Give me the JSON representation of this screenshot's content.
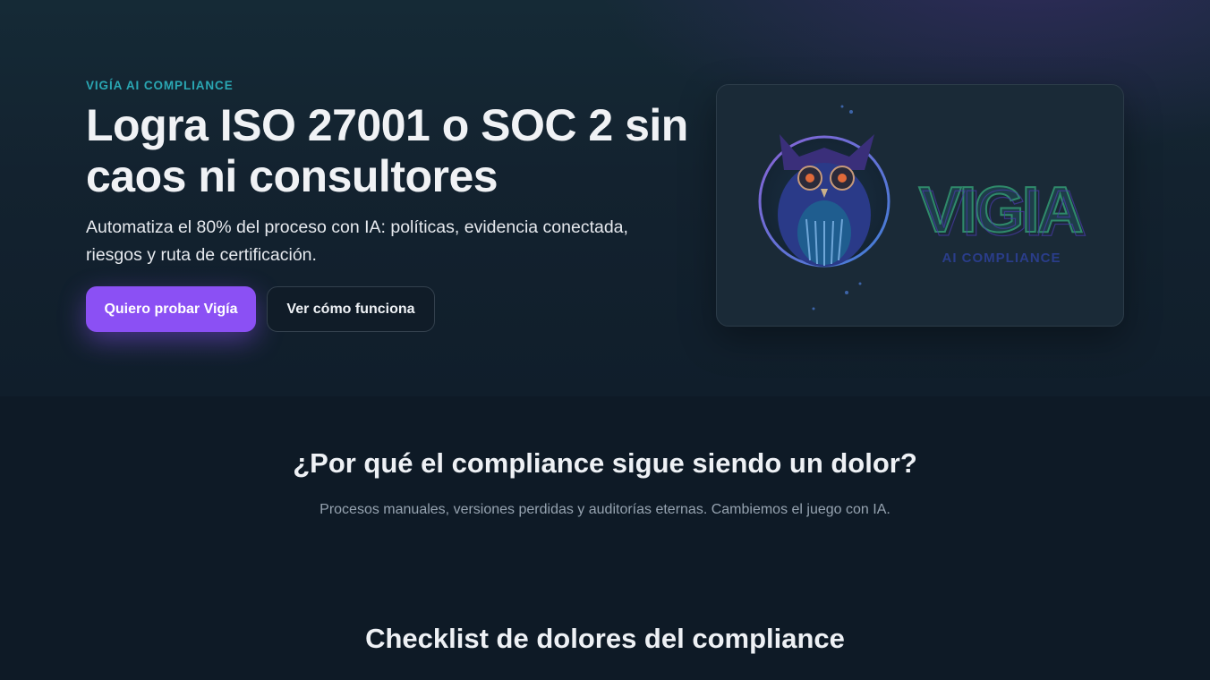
{
  "hero": {
    "eyebrow": "VIGÍA AI COMPLIANCE",
    "title": "Logra ISO 27001 o SOC 2 sin caos ni consultores",
    "subtitle": "Automatiza el 80% del proceso con IA: políticas, evidencia conectada, riesgos y ruta de certificación.",
    "primary_button": "Quiero probar Vigía",
    "secondary_button": "Ver cómo funciona",
    "logo": {
      "wordmark": "VIGIA",
      "tagline": "AI COMPLIANCE",
      "icon": "owl-icon"
    }
  },
  "pain_section": {
    "title": "¿Por qué el compliance sigue siendo un dolor?",
    "subtitle": "Procesos manuales, versiones perdidas y auditorías eternas. Cambiemos el juego con IA."
  },
  "checklist_section": {
    "title": "Checklist de dolores del compliance"
  },
  "colors": {
    "accent": "#8b50f4",
    "eyebrow": "#2aa7b3",
    "background": "#0e1a26"
  }
}
